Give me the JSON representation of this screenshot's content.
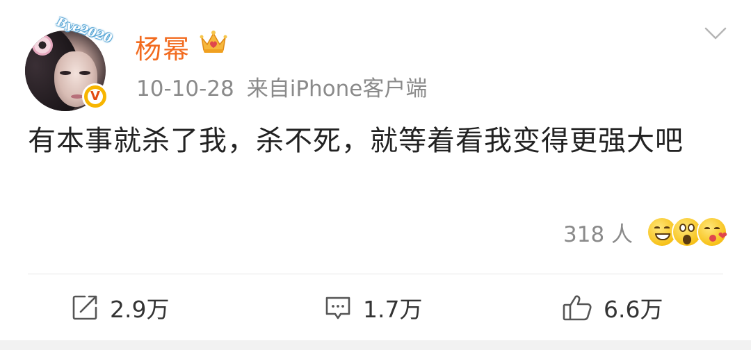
{
  "post": {
    "author": {
      "name": "杨幂",
      "avatar_badge_text": "Bye2020",
      "verified_icon": "verified-v-badge",
      "crown_icon": "member-crown-icon"
    },
    "date": "10-10-28",
    "source": "来自iPhone客户端",
    "text": "有本事就杀了我，杀不死，就等着看我变得更强大吧",
    "reactions": {
      "count_label": "318 人",
      "emojis": [
        "grinning-emoji-icon",
        "shocked-emoji-icon",
        "kiss-emoji-icon"
      ]
    },
    "actions": {
      "repost": "2.9万",
      "comment": "1.7万",
      "like": "6.6万"
    }
  },
  "colors": {
    "username": "#f26b1f",
    "meta": "#8a8a8a",
    "text": "#222222",
    "verified_bg": "#f7b500"
  }
}
